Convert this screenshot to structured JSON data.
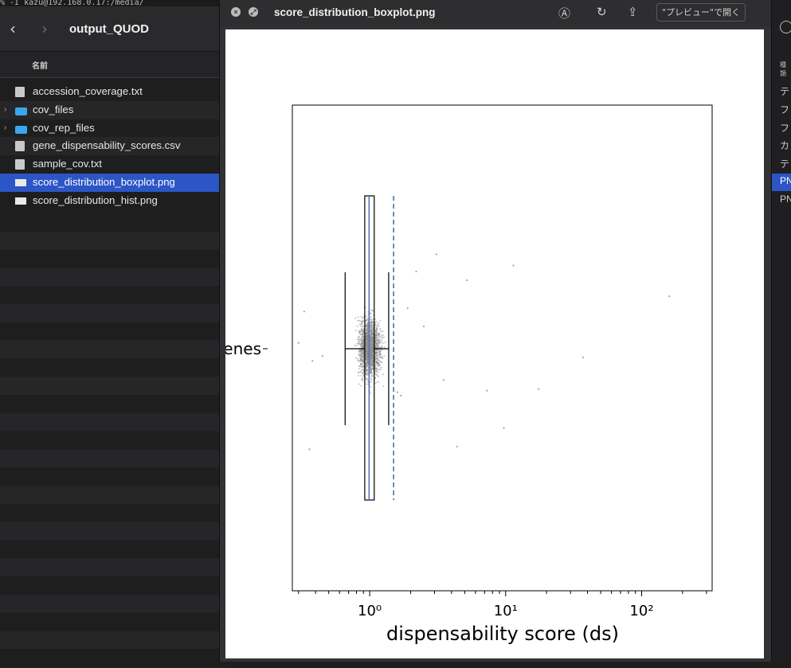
{
  "terminal": {
    "text": "% -I  kazu@192.168.0.17:/media/"
  },
  "finder": {
    "folder_title": "output_QUOD",
    "column_header": "名前",
    "files": [
      {
        "name": "accession_coverage.txt",
        "icon": "text-file-icon",
        "expandable": false,
        "selected": false
      },
      {
        "name": "cov_files",
        "icon": "folder-icon",
        "expandable": true,
        "selected": false
      },
      {
        "name": "cov_rep_files",
        "icon": "folder-icon",
        "expandable": true,
        "selected": false
      },
      {
        "name": "gene_dispensability_scores.csv",
        "icon": "text-file-icon",
        "expandable": false,
        "selected": false
      },
      {
        "name": "sample_cov.txt",
        "icon": "text-file-icon",
        "expandable": false,
        "selected": false
      },
      {
        "name": "score_distribution_boxplot.png",
        "icon": "image-file-icon",
        "expandable": false,
        "selected": true
      },
      {
        "name": "score_distribution_hist.png",
        "icon": "image-file-icon",
        "expandable": false,
        "selected": false
      }
    ]
  },
  "right_window": {
    "header": "種類",
    "kinds": [
      "テ",
      "フ",
      "フ",
      "カ",
      "テ",
      "PN",
      "PN"
    ]
  },
  "quicklook": {
    "title": "score_distribution_boxplot.png",
    "open_button": "\"プレビュー\"で開く"
  },
  "colors": {
    "selection": "#2c55c6",
    "mean_line": "#4c72b0",
    "points": "#8c8c8c"
  },
  "chart_data": {
    "type": "box",
    "orientation": "horizontal",
    "category": "genes",
    "xlabel": "dispensability score (ds)",
    "xscale": "log",
    "xlim": [
      0.27,
      330
    ],
    "x_tick_labels": [
      "10⁰",
      "10¹",
      "10²"
    ],
    "x_tick_values": [
      1,
      10,
      100
    ],
    "box": {
      "whisker_low": 0.66,
      "q1": 0.92,
      "median": 0.99,
      "q3": 1.08,
      "whisker_high": 1.38
    },
    "mean": 1.5,
    "box_label": "genes",
    "scatter_outliers": [
      0.3,
      0.33,
      0.36,
      0.38,
      0.45,
      1.6,
      1.7,
      1.9,
      2.2,
      2.5,
      3.1,
      3.5,
      4.4,
      5.2,
      7.3,
      9.7,
      11.4,
      17.5,
      37,
      160
    ],
    "grid": false
  }
}
